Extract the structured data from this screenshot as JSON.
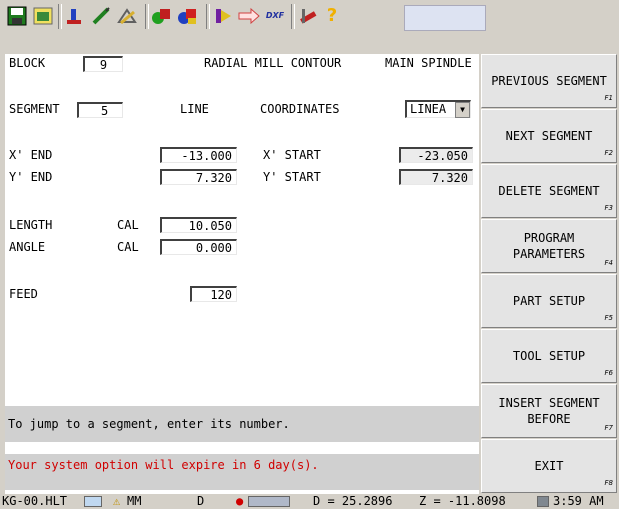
{
  "toolbar": {
    "icons": [
      "save-icon",
      "open-folder-icon",
      "tool-icon",
      "pencil-icon",
      "draw-icon",
      "shapes-icon",
      "shapes-color-icon",
      "flag-icon",
      "arrow-icon",
      "dxf-icon",
      "tools-icon",
      "help-icon"
    ],
    "dxf_label": "DXF",
    "help_label": "?"
  },
  "header": {
    "block_label": "BLOCK",
    "block_value": "9",
    "mode_title": "RADIAL MILL CONTOUR",
    "spindle": "MAIN SPINDLE"
  },
  "segment": {
    "label": "SEGMENT",
    "value": "5",
    "type": "LINE",
    "coordinates_label": "COORDINATES",
    "coordinates_value": "LINEA"
  },
  "coords": {
    "x_end_label": "X' END",
    "x_end": "-13.000",
    "y_end_label": "Y' END",
    "y_end": "7.320",
    "x_start_label": "X' START",
    "x_start": "-23.050",
    "y_start_label": "Y' START",
    "y_start": "7.320"
  },
  "geometry": {
    "length_label": "LENGTH",
    "length_mode": "CAL",
    "length": "10.050",
    "angle_label": "ANGLE",
    "angle_mode": "CAL",
    "angle": "0.000"
  },
  "feed": {
    "label": "FEED",
    "value": "120"
  },
  "messages": {
    "hint": "To jump to a segment, enter its number.",
    "warning": "Your system option will expire in 6 day(s)."
  },
  "softkeys": [
    {
      "label": "PREVIOUS SEGMENT",
      "key": "F1"
    },
    {
      "label": "NEXT SEGMENT",
      "key": "F2"
    },
    {
      "label": "DELETE SEGMENT",
      "key": "F3"
    },
    {
      "label": "PROGRAM\nPARAMETERS",
      "key": "F4"
    },
    {
      "label": "PART SETUP",
      "key": "F5"
    },
    {
      "label": "TOOL SETUP",
      "key": "F6"
    },
    {
      "label": "INSERT SEGMENT\nBEFORE",
      "key": "F7"
    },
    {
      "label": "EXIT",
      "key": "F8"
    }
  ],
  "status": {
    "file": "KG-00.HLT",
    "units": "MM",
    "mode": "D",
    "d_readout": "D = 25.2896",
    "z_readout": "Z = -11.8098",
    "time": "3:59 AM"
  }
}
